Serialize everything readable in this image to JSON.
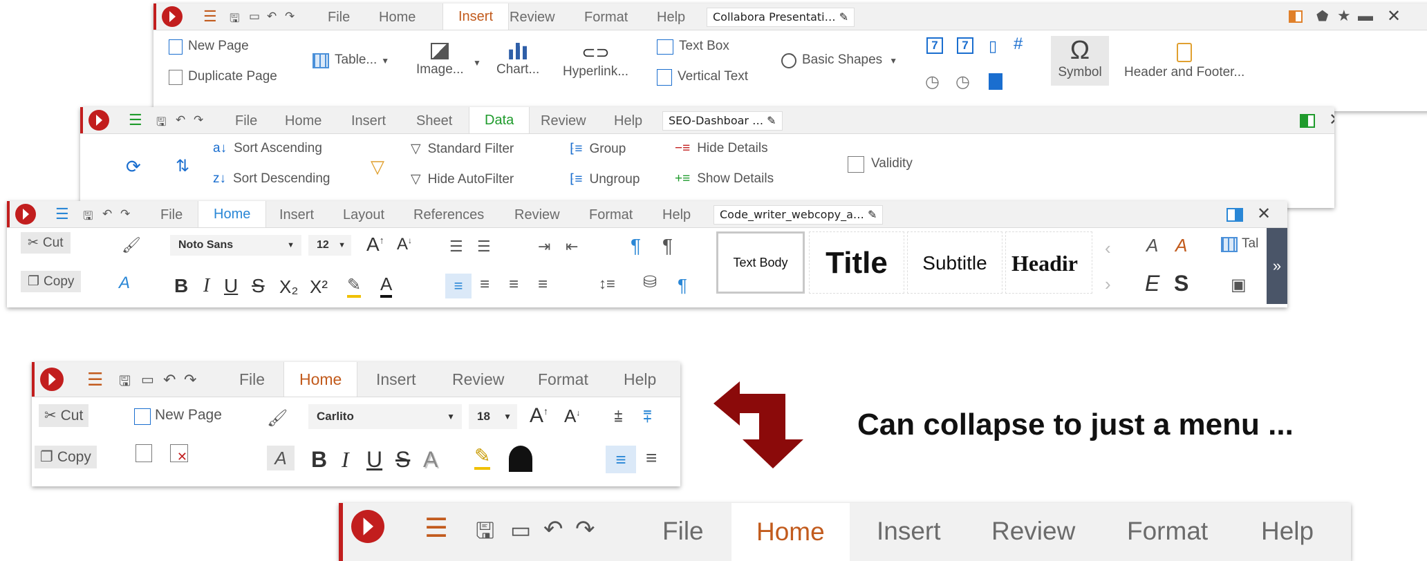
{
  "impress": {
    "tabs": [
      "File",
      "Home",
      "Insert",
      "Review",
      "Format",
      "Help"
    ],
    "active_tab": "Insert",
    "doc_title": "Collabora Presentati…",
    "buttons": {
      "new_page": "New Page",
      "duplicate_page": "Duplicate Page",
      "table": "Table...",
      "image": "Image...",
      "chart": "Chart...",
      "hyperlink": "Hyperlink...",
      "text_box": "Text Box",
      "vertical_text": "Vertical Text",
      "basic_shapes": "Basic Shapes",
      "symbol": "Symbol",
      "header_footer": "Header and Footer..."
    },
    "field_glyph": "7"
  },
  "calc": {
    "tabs": [
      "File",
      "Home",
      "Insert",
      "Sheet",
      "Data",
      "Review",
      "Help"
    ],
    "active_tab": "Data",
    "doc_title": "SEO-Dashboar …",
    "buttons": {
      "sort_asc": "Sort Ascending",
      "sort_desc": "Sort Descending",
      "standard_filter": "Standard Filter",
      "hide_autofilter": "Hide AutoFilter",
      "group": "Group",
      "ungroup": "Ungroup",
      "hide_details": "Hide Details",
      "show_details": "Show Details",
      "validity": "Validity"
    },
    "accent": "#1f9b2c"
  },
  "writer": {
    "tabs": [
      "File",
      "Home",
      "Insert",
      "Layout",
      "References",
      "Review",
      "Format",
      "Help"
    ],
    "active_tab": "Home",
    "doc_title": "Code_writer_webcopy_a…",
    "buttons": {
      "cut": "Cut",
      "copy": "Copy",
      "font_name": "Noto Sans",
      "font_size": "12",
      "bold": "B",
      "italic": "I",
      "underline": "U",
      "strike": "S",
      "sub": "X₂",
      "sup": "X²",
      "insert_table": "Tal",
      "more": "»"
    },
    "styles": [
      "Text Body",
      "Title",
      "Subtitle",
      "Headir"
    ],
    "style_side": [
      "E",
      "S"
    ],
    "accent": "#2a87d6"
  },
  "compact": {
    "tabs": [
      "File",
      "Home",
      "Insert",
      "Review",
      "Format",
      "Help"
    ],
    "active_tab": "Home",
    "buttons": {
      "cut": "Cut",
      "copy": "Copy",
      "new_page": "New Page",
      "font_name": "Carlito",
      "font_size": "18",
      "bold": "B",
      "italic": "I",
      "underline": "U",
      "strike": "S",
      "shadow": "A"
    },
    "accent": "#c25b1d"
  },
  "menu_only": {
    "tabs": [
      "File",
      "Home",
      "Insert",
      "Review",
      "Format",
      "Help"
    ],
    "active_tab": "Home",
    "accent": "#c25b1d"
  },
  "caption": "Can collapse to just a menu ...",
  "colors": {
    "logo_red": "#c21e1e",
    "arrow_red": "#8b0a0a"
  }
}
